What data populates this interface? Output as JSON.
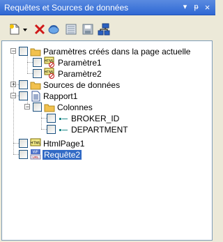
{
  "window": {
    "title": "Requêtes et Sources de données",
    "buttons": {
      "dropdown": "▾",
      "pin": "ᵽ",
      "close": "×"
    }
  },
  "toolbar": {
    "tools": [
      "new-document-icon",
      "dropdown-arrow-icon",
      "delete-icon",
      "refresh-icon",
      "properties-icon",
      "save-icon",
      "hierarchy-icon"
    ]
  },
  "tree": {
    "params_root": "Paramètres créés dans la page actuelle",
    "param1": "Paramètre1",
    "param2": "Paramètre2",
    "sources": "Sources de données",
    "rapport": "Rapport1",
    "colonnes": "Colonnes",
    "broker": "BROKER_ID",
    "dept": "DEPARTMENT",
    "html": "HtmlPage1",
    "requete": "Requête2"
  },
  "icon_text": {
    "html_small": "HTML",
    "wf": "WF",
    "url": "URL"
  },
  "colors": {
    "selection": "#316ac5",
    "folder": "#f2c14e",
    "title_bar": "#2f68d4"
  }
}
